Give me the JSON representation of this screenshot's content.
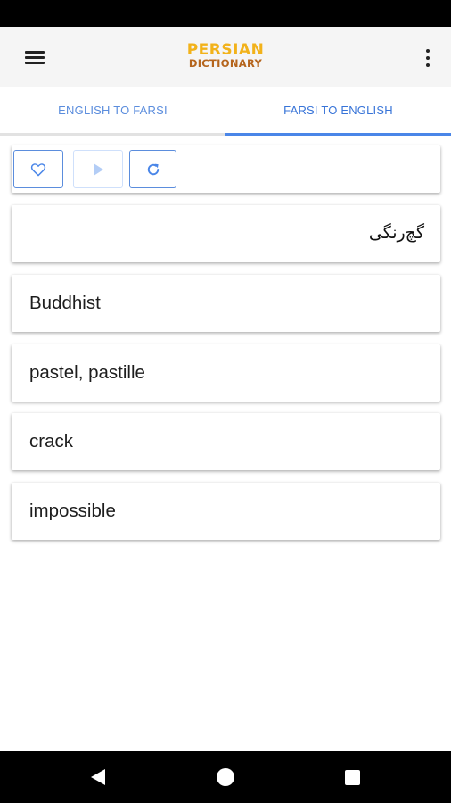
{
  "app": {
    "logo_line1": "PERSIAN",
    "logo_line2": "DICTIONARY"
  },
  "tabs": [
    {
      "label": "ENGLISH TO FARSI",
      "active": false
    },
    {
      "label": "FARSI TO ENGLISH",
      "active": true
    }
  ],
  "toolbar": {
    "favorite_icon": "heart-icon",
    "play_icon": "play-icon",
    "refresh_icon": "refresh-icon"
  },
  "question": {
    "word": "گچ‌رنگی"
  },
  "options": [
    {
      "label": "Buddhist"
    },
    {
      "label": "pastel, pastille"
    },
    {
      "label": "crack"
    },
    {
      "label": "impossible"
    }
  ],
  "colors": {
    "accent": "#4a86e8",
    "logo_primary": "#f2b21a",
    "logo_secondary": "#b5651d",
    "app_bar_bg": "#f5f5f5"
  }
}
